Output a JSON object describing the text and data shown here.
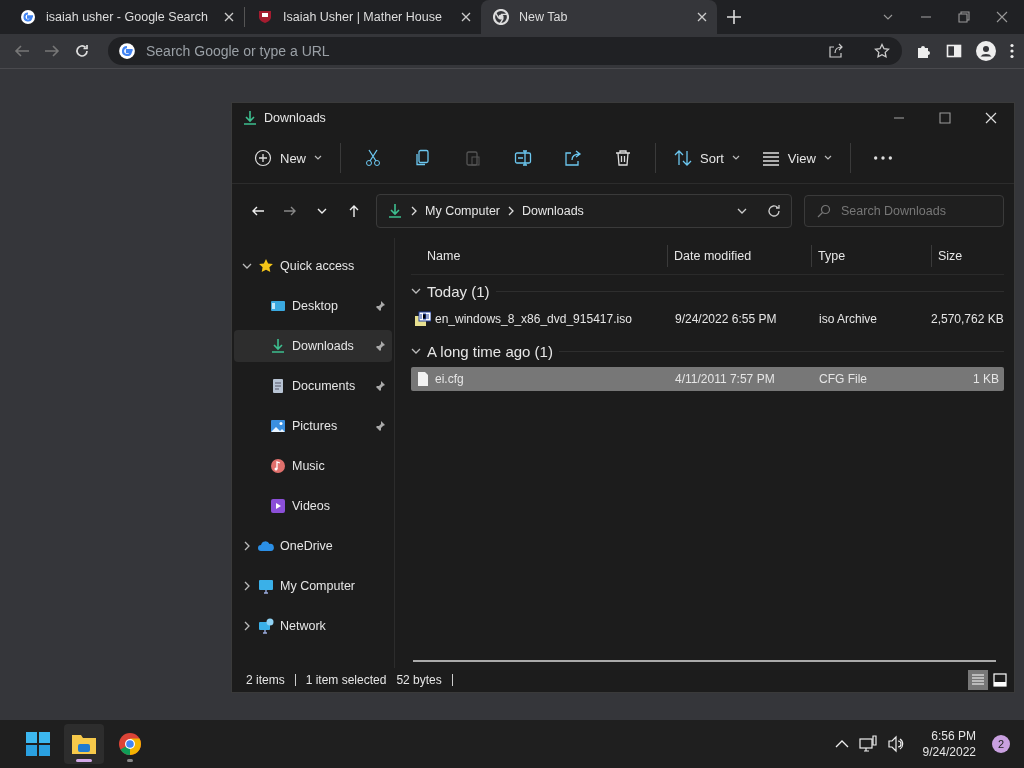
{
  "browser": {
    "tabs": [
      {
        "title": "isaiah usher - Google Search",
        "kind": "google",
        "selected": false
      },
      {
        "title": "Isaiah Usher | Mather House",
        "kind": "shield",
        "selected": false
      },
      {
        "title": "New Tab",
        "kind": "chrome",
        "selected": true
      }
    ],
    "omnibox": {
      "placeholder": "Search Google or type a URL"
    }
  },
  "explorer": {
    "title": "Downloads",
    "toolbar": [
      {
        "kind": "new",
        "label": "New",
        "disabled": false
      },
      {
        "kind": "cut",
        "disabled": false
      },
      {
        "kind": "copy",
        "disabled": false
      },
      {
        "kind": "paste",
        "disabled": true
      },
      {
        "kind": "rename",
        "disabled": false
      },
      {
        "kind": "share",
        "disabled": false
      },
      {
        "kind": "delete",
        "disabled": false
      },
      {
        "kind": "sort",
        "label": "Sort",
        "disabled": false
      },
      {
        "kind": "view",
        "label": "View",
        "disabled": false
      },
      {
        "kind": "more",
        "disabled": false
      }
    ],
    "breadcrumb": [
      "My Computer",
      "Downloads"
    ],
    "search": {
      "placeholder": "Search Downloads"
    },
    "sidebar": [
      {
        "label": "Quick access",
        "kind": "star",
        "expanded": true,
        "selected": false,
        "children": [
          {
            "label": "Desktop",
            "kind": "desktop",
            "pinned": true,
            "selected": false
          },
          {
            "label": "Downloads",
            "kind": "downloads",
            "pinned": true,
            "selected": true
          },
          {
            "label": "Documents",
            "kind": "documents",
            "pinned": true,
            "selected": false
          },
          {
            "label": "Pictures",
            "kind": "pictures",
            "pinned": true,
            "selected": false
          },
          {
            "label": "Music",
            "kind": "music",
            "pinned": false,
            "selected": false
          },
          {
            "label": "Videos",
            "kind": "videos",
            "pinned": false,
            "selected": false
          }
        ]
      },
      {
        "label": "OneDrive",
        "kind": "onedrive",
        "expanded": false,
        "selected": false
      },
      {
        "label": "My Computer",
        "kind": "computer",
        "expanded": false,
        "selected": false
      },
      {
        "label": "Network",
        "kind": "network",
        "expanded": false,
        "selected": false
      }
    ],
    "columns": [
      "Name",
      "Date modified",
      "Type",
      "Size"
    ],
    "groups": [
      {
        "label": "Today (1)",
        "expanded": true,
        "files": [
          {
            "name": "en_windows_8_x86_dvd_915417.iso",
            "kind": "iso",
            "date": "9/24/2022 6:55 PM",
            "type": "iso Archive",
            "size": "2,570,762 KB",
            "selected": false
          }
        ]
      },
      {
        "label": "A long time ago (1)",
        "expanded": true,
        "files": [
          {
            "name": "ei.cfg",
            "kind": "file",
            "date": "4/11/2011 7:57 PM",
            "type": "CFG File",
            "size": "1 KB",
            "selected": true
          }
        ]
      }
    ],
    "status": [
      "2 items",
      "1 item selected",
      "52 bytes"
    ],
    "views": [
      {
        "kind": "details",
        "selected": true
      },
      {
        "kind": "tiles",
        "selected": false
      }
    ]
  },
  "taskbar": {
    "apps": [
      {
        "kind": "start",
        "active": false
      },
      {
        "kind": "explorer",
        "active": true
      },
      {
        "kind": "chrome",
        "active": false
      }
    ],
    "time": "6:56 PM",
    "date": "9/24/2022",
    "notifications": "2"
  }
}
